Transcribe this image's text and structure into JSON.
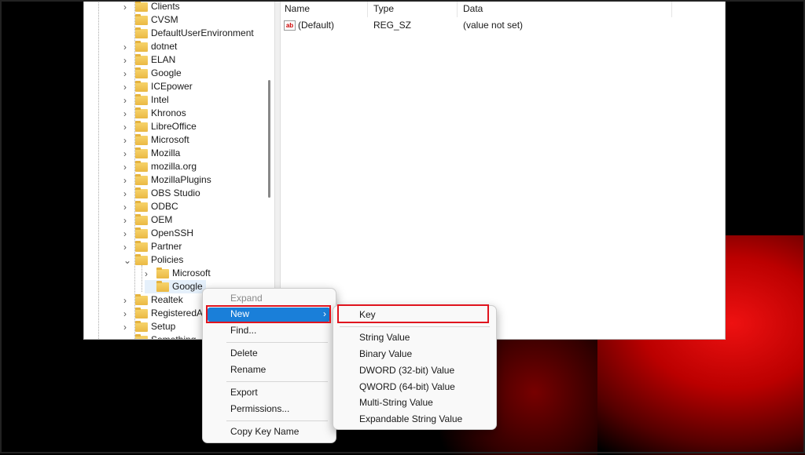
{
  "tree": {
    "items": [
      {
        "label": "Clients",
        "arrow": "›"
      },
      {
        "label": "CVSM",
        "arrow": ""
      },
      {
        "label": "DefaultUserEnvironment",
        "arrow": ""
      },
      {
        "label": "dotnet",
        "arrow": "›"
      },
      {
        "label": "ELAN",
        "arrow": "›"
      },
      {
        "label": "Google",
        "arrow": "›"
      },
      {
        "label": "ICEpower",
        "arrow": "›"
      },
      {
        "label": "Intel",
        "arrow": "›"
      },
      {
        "label": "Khronos",
        "arrow": "›"
      },
      {
        "label": "LibreOffice",
        "arrow": "›"
      },
      {
        "label": "Microsoft",
        "arrow": "›"
      },
      {
        "label": "Mozilla",
        "arrow": "›"
      },
      {
        "label": "mozilla.org",
        "arrow": "›"
      },
      {
        "label": "MozillaPlugins",
        "arrow": "›"
      },
      {
        "label": "OBS Studio",
        "arrow": "›"
      },
      {
        "label": "ODBC",
        "arrow": "›"
      },
      {
        "label": "OEM",
        "arrow": "›"
      },
      {
        "label": "OpenSSH",
        "arrow": "›"
      },
      {
        "label": "Partner",
        "arrow": "›"
      },
      {
        "label": "Policies",
        "arrow": "⌄"
      },
      {
        "label": "Microsoft",
        "arrow": "›"
      },
      {
        "label": "Google",
        "arrow": ""
      },
      {
        "label": "Realtek",
        "arrow": "›"
      },
      {
        "label": "RegisteredAp",
        "arrow": "›"
      },
      {
        "label": "Setup",
        "arrow": "›"
      },
      {
        "label": "Something",
        "arrow": "›"
      }
    ]
  },
  "list": {
    "headers": {
      "name": "Name",
      "type": "Type",
      "data": "Data"
    },
    "rows": [
      {
        "icon": "ab",
        "name": "(Default)",
        "type": "REG_SZ",
        "data": "(value not set)"
      }
    ]
  },
  "context_menu": {
    "expand": "Expand",
    "new": "New",
    "find": "Find...",
    "delete": "Delete",
    "rename": "Rename",
    "export": "Export",
    "permissions": "Permissions...",
    "copy_key_name": "Copy Key Name",
    "submenu_arrow": "›"
  },
  "submenu": {
    "key": "Key",
    "string_value": "String Value",
    "binary_value": "Binary Value",
    "dword": "DWORD (32-bit) Value",
    "qword": "QWORD (64-bit) Value",
    "multi_string": "Multi-String Value",
    "expandable_string": "Expandable String Value"
  },
  "colors": {
    "highlight": "#1a7fd9",
    "annotation": "#e0141e",
    "folder": "#eab943"
  }
}
